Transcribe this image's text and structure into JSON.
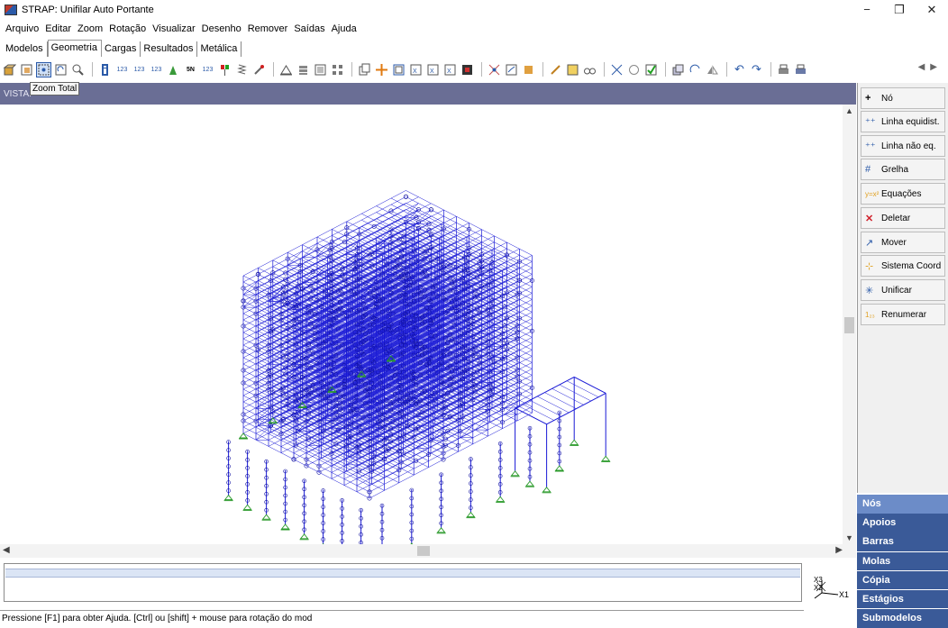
{
  "window": {
    "title": "STRAP: Unifilar Auto Portante",
    "controls": [
      "−",
      "❐",
      "✕"
    ]
  },
  "menu": [
    "Arquivo",
    "Editar",
    "Zoom",
    "Rotação",
    "Visualizar",
    "Desenho",
    "Remover",
    "Saídas",
    "Ajuda"
  ],
  "tabs": [
    {
      "label": "Modelos",
      "active": false
    },
    {
      "label": "Geometria",
      "active": true
    },
    {
      "label": "Cargas",
      "active": false
    },
    {
      "label": "Resultados",
      "active": false
    },
    {
      "label": "Metálica",
      "active": false
    }
  ],
  "toolbar": {
    "tooltip": "Zoom Total",
    "label_123": "123",
    "label_sn": "5N"
  },
  "vista": {
    "label": "VISTA:"
  },
  "right_panel": {
    "buttons": [
      {
        "label": "Nó",
        "icon": "plus-icon"
      },
      {
        "label": "Linha equidist.",
        "icon": "equidistant-line-icon"
      },
      {
        "label": "Linha não eq.",
        "icon": "non-equidistant-line-icon"
      },
      {
        "label": "Grelha",
        "icon": "grid-icon"
      },
      {
        "label": "Equações",
        "icon": "equations-icon"
      },
      {
        "label": "Deletar",
        "icon": "delete-x-icon"
      },
      {
        "label": "Mover",
        "icon": "move-icon"
      },
      {
        "label": "Sistema Coord",
        "icon": "coordinate-system-icon"
      },
      {
        "label": "Unificar",
        "icon": "unify-icon"
      },
      {
        "label": "Renumerar",
        "icon": "renumber-icon"
      }
    ]
  },
  "categories": [
    {
      "label": "Nós",
      "active": true
    },
    {
      "label": "Apoios",
      "active": false
    },
    {
      "label": "Barras",
      "active": false
    },
    {
      "label": "Molas",
      "active": false
    },
    {
      "label": "Cópia",
      "active": false
    },
    {
      "label": "Estágios",
      "active": false
    },
    {
      "label": "Submodelos",
      "active": false
    }
  ],
  "axes": {
    "x": "X1",
    "y": "X2",
    "z": "X3"
  },
  "status": "Pressione [F1] para obter Ajuda. [Ctrl] ou [shift] + mouse para rotação do mod",
  "colors": {
    "frame": "#1a1ad6",
    "supports": "#2a9a2a",
    "panel_header": "#6a6e95",
    "category": "#3a5a98"
  }
}
